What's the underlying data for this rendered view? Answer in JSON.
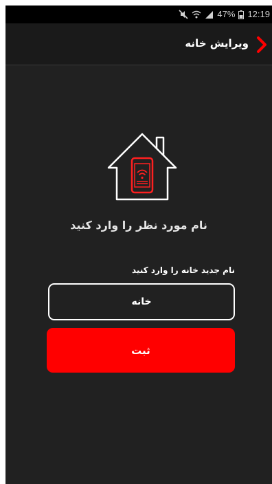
{
  "status_bar": {
    "battery": "47%",
    "time": "12:19",
    "icons": [
      "mute-icon",
      "wifi-icon",
      "signal-icon",
      "battery-icon"
    ]
  },
  "app_bar": {
    "title": "ویرایش خانه",
    "back_icon": "chevron-right-icon"
  },
  "main": {
    "icon": "smart-home-device-icon",
    "prompt": "نام مورد نظر را وارد کنید",
    "field_label": "نام جدید خانه را وارد کنید",
    "name_value": "خانه",
    "submit_label": "ثبت"
  },
  "colors": {
    "background": "#212121",
    "accent": "#ff0000",
    "text": "#ffffff"
  }
}
